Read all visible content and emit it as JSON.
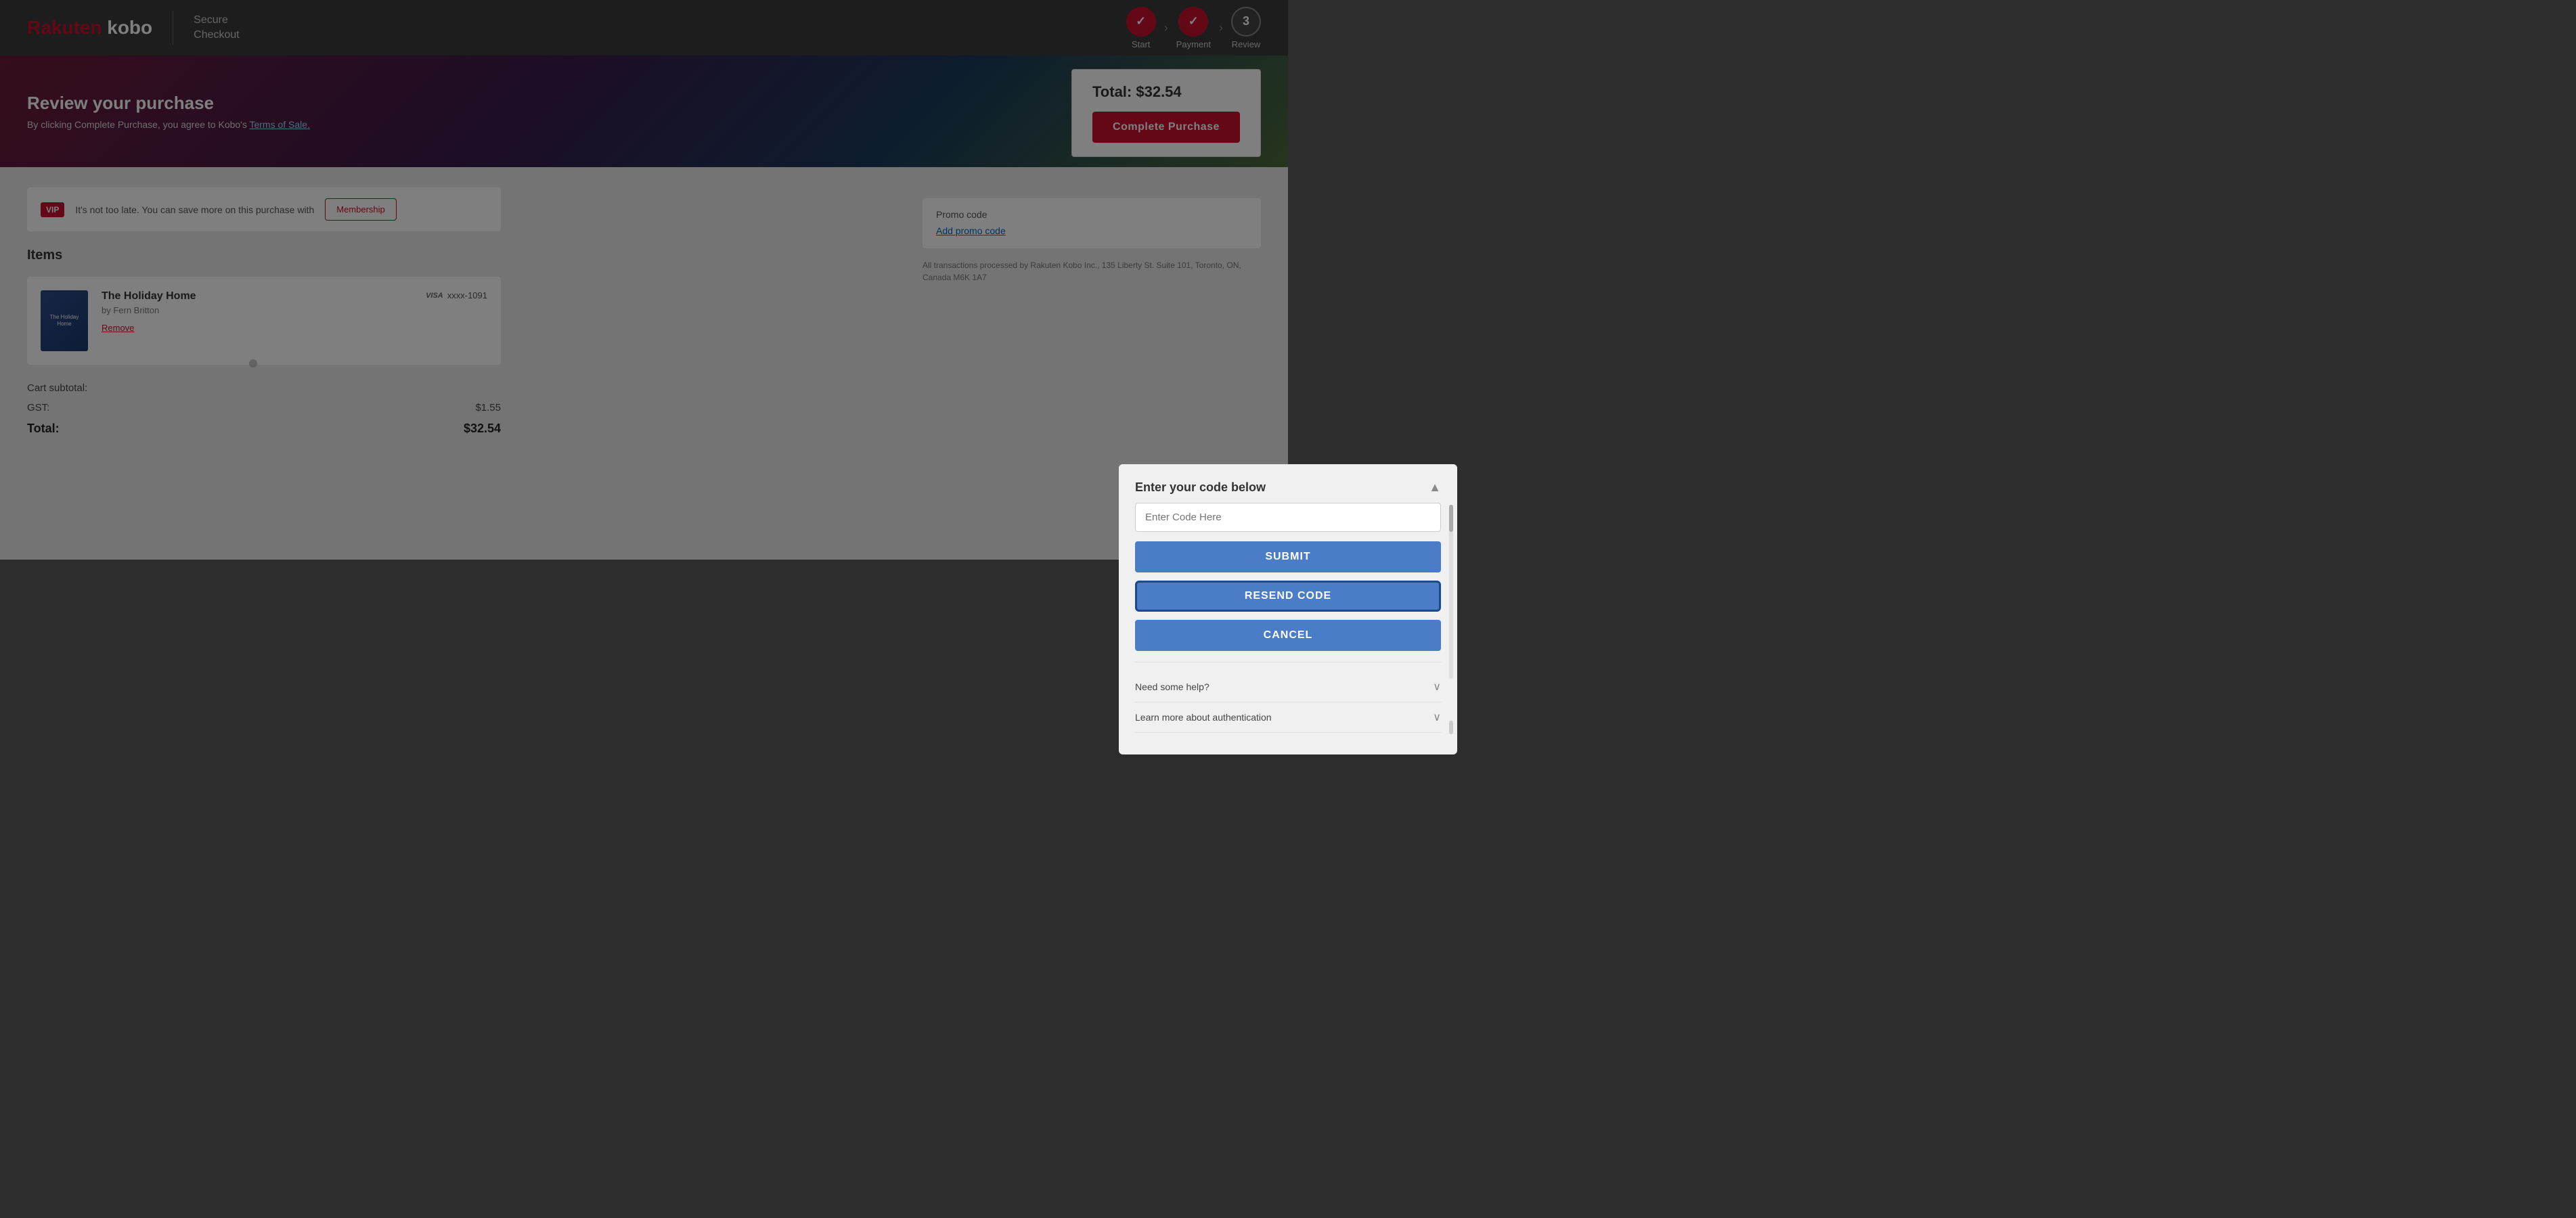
{
  "header": {
    "logo_rakuten": "Rakuten",
    "logo_kobo": "kobo",
    "secure_checkout_line1": "Secure",
    "secure_checkout_line2": "Checkout",
    "steps": [
      {
        "label": "Start",
        "state": "completed",
        "number": "✓"
      },
      {
        "label": "Payment",
        "state": "completed",
        "number": "✓"
      },
      {
        "label": "Review",
        "state": "current",
        "number": "3"
      }
    ]
  },
  "hero": {
    "title": "Review your purchase",
    "subtitle_prefix": "By clicking Complete Purchase, you agree to Kobo's ",
    "terms_link": "Terms of Sale.",
    "total_label": "Total: $32.54",
    "complete_purchase_btn": "Complete Purchase"
  },
  "vip": {
    "badge": "VIP",
    "text": "It's not too late. You can save more on this purchase with",
    "button": "Membership"
  },
  "items": {
    "section_title": "Items",
    "list": [
      {
        "title": "The Holiday Home",
        "author": "by Fern Britton",
        "remove_label": "Remove",
        "visa_label": "VISA xxxx-1091"
      }
    ]
  },
  "totals": {
    "subtotal_label": "Cart subtotal:",
    "gst_label": "GST:",
    "gst_value": "$1.55",
    "total_label": "Total:",
    "total_value": "$32.54"
  },
  "promo": {
    "label": "Promo code",
    "link": "Add promo code"
  },
  "footer_note": "All transactions processed by Rakuten Kobo Inc., 135 Liberty St. Suite 101, Toronto, ON, Canada M6K 1A7",
  "modal": {
    "title": "Enter your code below",
    "input_placeholder": "Enter Code Here",
    "submit_btn": "SUBMIT",
    "resend_btn": "RESEND CODE",
    "cancel_btn": "CANCEL",
    "help_label": "Need some help?",
    "auth_label": "Learn more about authentication"
  }
}
